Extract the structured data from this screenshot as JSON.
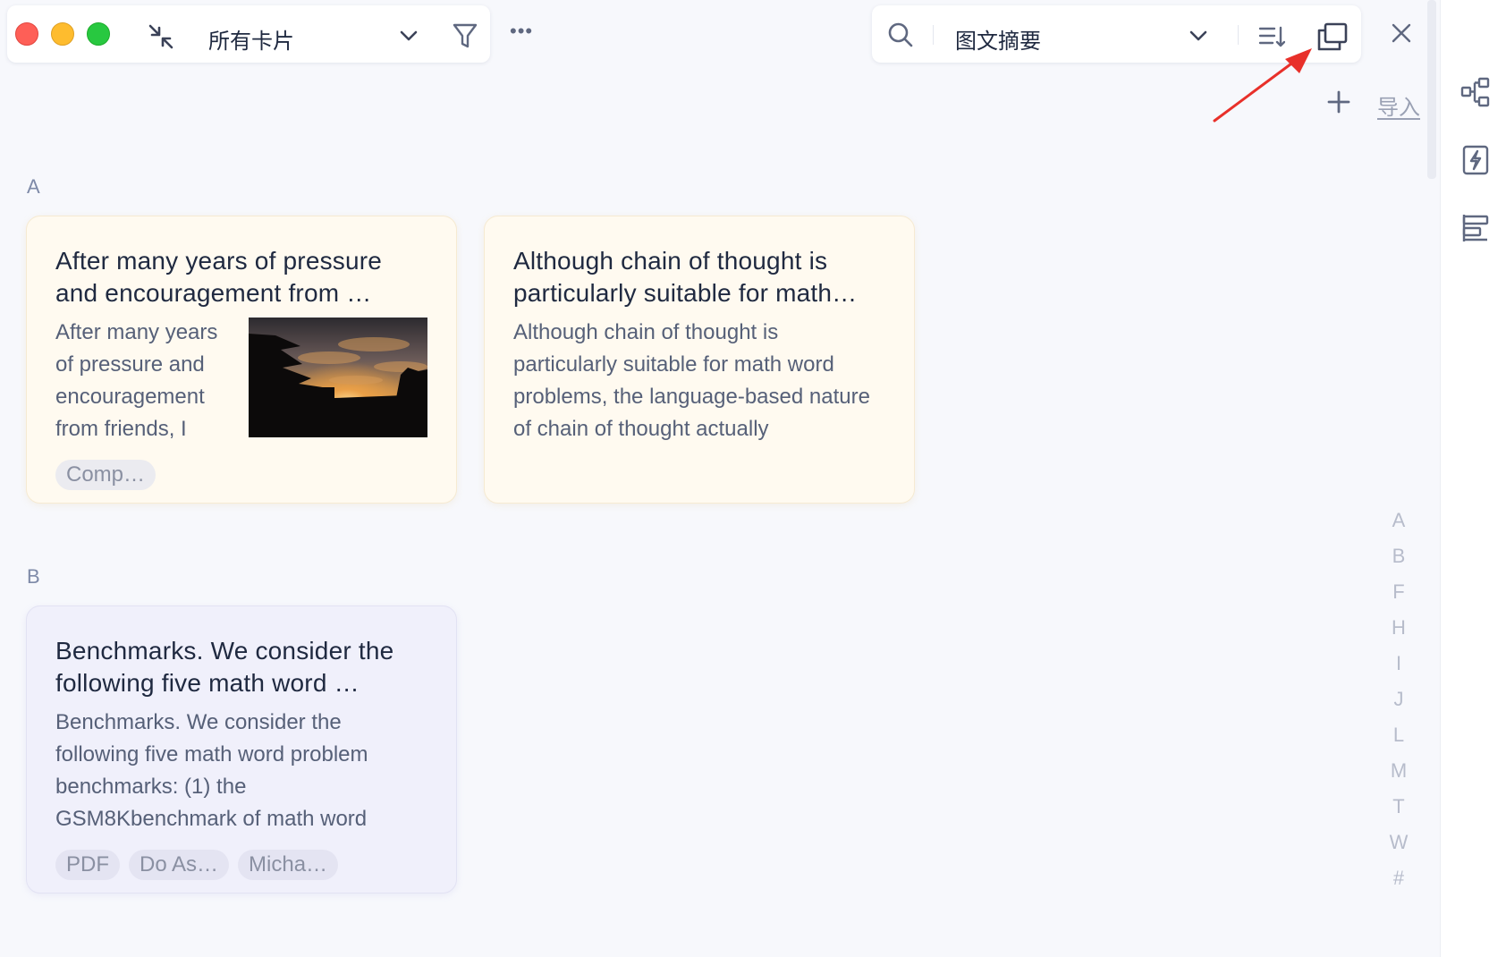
{
  "toolbar": {
    "view_label": "所有卡片",
    "mode_label": "图文摘要",
    "more_label": "•••",
    "import_label": "导入"
  },
  "sections": [
    {
      "letter": "A",
      "cards": [
        {
          "title": "After many years of pressure and encouragement from …",
          "body": "After many years of pressure and encouragement from friends, I",
          "has_image": true,
          "tags": [
            "Comp…"
          ]
        },
        {
          "title": "Although chain of thought is particularly suitable for math…",
          "body": "Although chain of thought is particularly suitable for math word problems, the language-based nature of chain of thought actually",
          "has_image": false,
          "tags": []
        }
      ]
    },
    {
      "letter": "B",
      "cards": [
        {
          "title": "Benchmarks. We consider the following five math word …",
          "body": "Benchmarks. We consider the following five math word problem benchmarks: (1) the GSM8Kbenchmark of math word",
          "has_image": false,
          "tags": [
            "PDF",
            "Do As…",
            "Micha…"
          ]
        }
      ]
    }
  ],
  "alpha_index": [
    "A",
    "B",
    "F",
    "H",
    "I",
    "J",
    "L",
    "M",
    "T",
    "W",
    "#"
  ],
  "icons": {
    "traffic_lights": [
      "close-dot",
      "minimize-dot",
      "zoom-dot"
    ],
    "toolbar": [
      "collapse-icon",
      "chevron-down-icon",
      "filter-icon",
      "more-icon",
      "search-icon",
      "chevron-down-icon",
      "sort-icon",
      "window-icon",
      "close-icon",
      "plus-icon"
    ],
    "rail": [
      "mindmap-icon",
      "flash-card-icon",
      "align-icon"
    ]
  },
  "colors": {
    "background": "#f7f8fc",
    "card_yellow": "#fffaf0",
    "card_purple": "#f0f0fb",
    "annotation_arrow": "#e8302a",
    "traffic_red": "#fe5f57",
    "traffic_yellow": "#febc2e",
    "traffic_green": "#28c840"
  }
}
